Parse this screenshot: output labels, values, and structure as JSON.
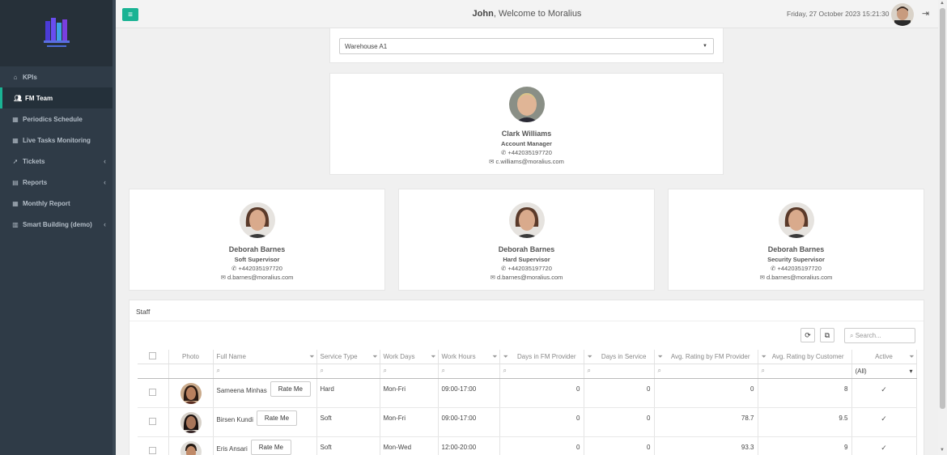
{
  "sidebar": {
    "items": [
      {
        "label": "KPIs",
        "icon": "home-icon"
      },
      {
        "label": "FM Team",
        "icon": "users-icon",
        "active": true
      },
      {
        "label": "Periodics Schedule",
        "icon": "calendar-icon"
      },
      {
        "label": "Live Tasks Monitoring",
        "icon": "calendar-icon"
      },
      {
        "label": "Tickets",
        "icon": "rocket-icon",
        "has_submenu": true
      },
      {
        "label": "Reports",
        "icon": "book-icon",
        "has_submenu": true
      },
      {
        "label": "Monthly Report",
        "icon": "calendar-icon"
      },
      {
        "label": "Smart Building (demo)",
        "icon": "bar-chart-icon",
        "has_submenu": true
      }
    ]
  },
  "header": {
    "user": "John",
    "welcome_suffix": ", Welcome to Moralius",
    "datetime": "Friday, 27 October 2023 15:21:30"
  },
  "warehouse_select": {
    "value": "Warehouse A1"
  },
  "manager": {
    "name": "Clark Williams",
    "role": "Account Manager",
    "phone": "+442035197720",
    "email": "c.williams@moralius.com"
  },
  "supervisors": [
    {
      "name": "Deborah Barnes",
      "role": "Soft Supervisor",
      "phone": "+442035197720",
      "email": "d.barnes@moralius.com"
    },
    {
      "name": "Deborah Barnes",
      "role": "Hard Supervisor",
      "phone": "+442035197720",
      "email": "d.barnes@moralius.com"
    },
    {
      "name": "Deborah Barnes",
      "role": "Security Supervisor",
      "phone": "+442035197720",
      "email": "d.barnes@moralius.com"
    }
  ],
  "staff": {
    "title": "Staff",
    "search_placeholder": "Search...",
    "columns": {
      "photo": "Photo",
      "full_name": "Full Name",
      "service_type": "Service Type",
      "work_days": "Work Days",
      "work_hours": "Work Hours",
      "days_fm": "Days in FM Provider",
      "days_service": "Days in Service",
      "rating_fm": "Avg. Rating by FM Provider",
      "rating_customer": "Avg. Rating by Customer",
      "active": "Active"
    },
    "active_filter": "(All)",
    "rate_label": "Rate Me",
    "rows": [
      {
        "name": "Sameena Minhas",
        "service": "Hard",
        "days": "Mon-Fri",
        "hours": "09:00-17:00",
        "days_fm": "0",
        "days_service": "0",
        "rating_fm": "0",
        "rating_customer": "8"
      },
      {
        "name": "Birsen Kundi",
        "service": "Soft",
        "days": "Mon-Fri",
        "hours": "09:00-17:00",
        "days_fm": "0",
        "days_service": "0",
        "rating_fm": "78.7",
        "rating_customer": "9.5"
      },
      {
        "name": "Eris Ansari",
        "service": "Soft",
        "days": "Mon-Wed",
        "hours": "12:00-20:00",
        "days_fm": "0",
        "days_service": "0",
        "rating_fm": "93.3",
        "rating_customer": "9"
      }
    ]
  },
  "colors": {
    "accent": "#1ab394",
    "sidebar": "#2f3b47"
  }
}
